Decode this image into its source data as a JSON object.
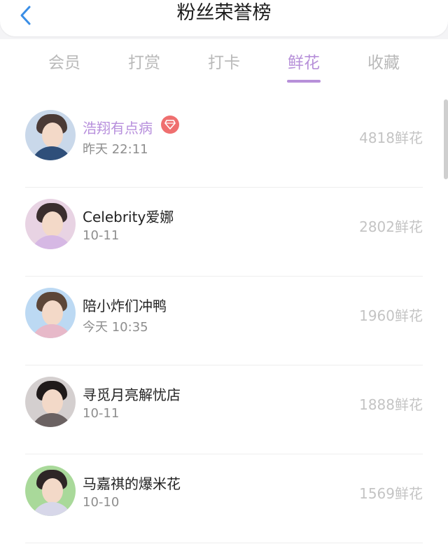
{
  "header": {
    "title": "粉丝荣誉榜",
    "back_icon": "chevron-left-icon",
    "accent_color": "#3a8ee6"
  },
  "tabs": [
    {
      "label": "会员",
      "active": false
    },
    {
      "label": "打赏",
      "active": false
    },
    {
      "label": "打卡",
      "active": false
    },
    {
      "label": "鲜花",
      "active": true
    },
    {
      "label": "收藏",
      "active": false
    }
  ],
  "theme": {
    "active_tab_color": "#b790d9",
    "highlight_name_color": "#b78fdc",
    "badge_color": "#ef6f6f"
  },
  "list": [
    {
      "name": "浩翔有点病",
      "time": "昨天 22:11",
      "amount": "4818鲜花",
      "highlight": true,
      "badge": "diamond-icon"
    },
    {
      "name": "Celebrity爱娜",
      "time": "10-11",
      "amount": "2802鲜花",
      "highlight": false
    },
    {
      "name": "陪小炸们冲鸭",
      "time": "今天 10:35",
      "amount": "1960鲜花",
      "highlight": false
    },
    {
      "name": "寻觅月亮解忧店",
      "time": "10-11",
      "amount": "1888鲜花",
      "highlight": false
    },
    {
      "name": "马嘉祺的爆米花",
      "time": "10-10",
      "amount": "1569鲜花",
      "highlight": false
    }
  ]
}
